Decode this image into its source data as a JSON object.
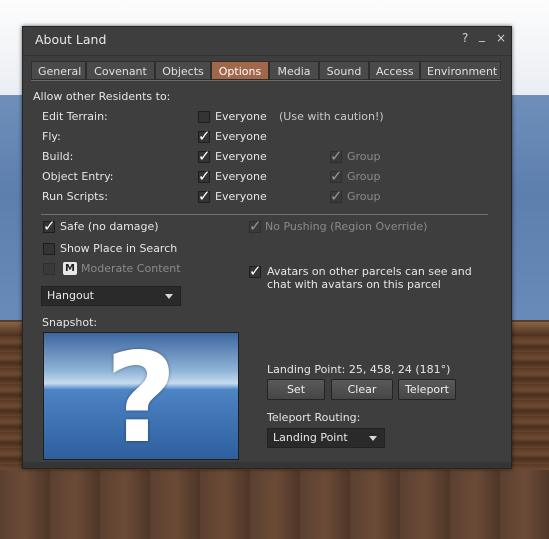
{
  "window": {
    "title": "About Land",
    "help_glyph": "?",
    "minimize_glyph": "_",
    "close_glyph": "×"
  },
  "tabs": [
    {
      "label": "General",
      "active": false
    },
    {
      "label": "Covenant",
      "active": false
    },
    {
      "label": "Objects",
      "active": false
    },
    {
      "label": "Options",
      "active": true
    },
    {
      "label": "Media",
      "active": false
    },
    {
      "label": "Sound",
      "active": false
    },
    {
      "label": "Access",
      "active": false
    },
    {
      "label": "Environment",
      "active": false
    }
  ],
  "permissions": {
    "heading": "Allow other Residents to:",
    "rows": [
      {
        "label": "Edit Terrain:",
        "everyone_label": "Everyone",
        "everyone_checked": false,
        "note": "(Use with caution!)"
      },
      {
        "label": "Fly:",
        "everyone_label": "Everyone",
        "everyone_checked": true
      },
      {
        "label": "Build:",
        "everyone_label": "Everyone",
        "everyone_checked": true,
        "group_label": "Group",
        "group_checked": true
      },
      {
        "label": "Object Entry:",
        "everyone_label": "Everyone",
        "everyone_checked": true,
        "group_label": "Group",
        "group_checked": true
      },
      {
        "label": "Run Scripts:",
        "everyone_label": "Everyone",
        "everyone_checked": true,
        "group_label": "Group",
        "group_checked": true
      }
    ]
  },
  "options": {
    "safe_label": "Safe (no damage)",
    "safe_checked": true,
    "no_pushing_label": "No Pushing (Region Override)",
    "no_pushing_checked": true,
    "show_in_search_label": "Show Place in Search",
    "show_in_search_checked": false,
    "moderate_badge": "M",
    "moderate_label": "Moderate Content",
    "moderate_checked": false,
    "avatars_label_line1": "Avatars on other parcels can see and",
    "avatars_label_line2": "chat with avatars on this parcel",
    "avatars_checked": true,
    "category_value": "Hangout"
  },
  "snapshot": {
    "label": "Snapshot:",
    "placeholder_glyph": "?"
  },
  "landing": {
    "point_text": "Landing Point: 25, 458, 24 (181°)",
    "set_label": "Set",
    "clear_label": "Clear",
    "teleport_label": "Teleport",
    "routing_label": "Teleport Routing:",
    "routing_value": "Landing Point"
  }
}
